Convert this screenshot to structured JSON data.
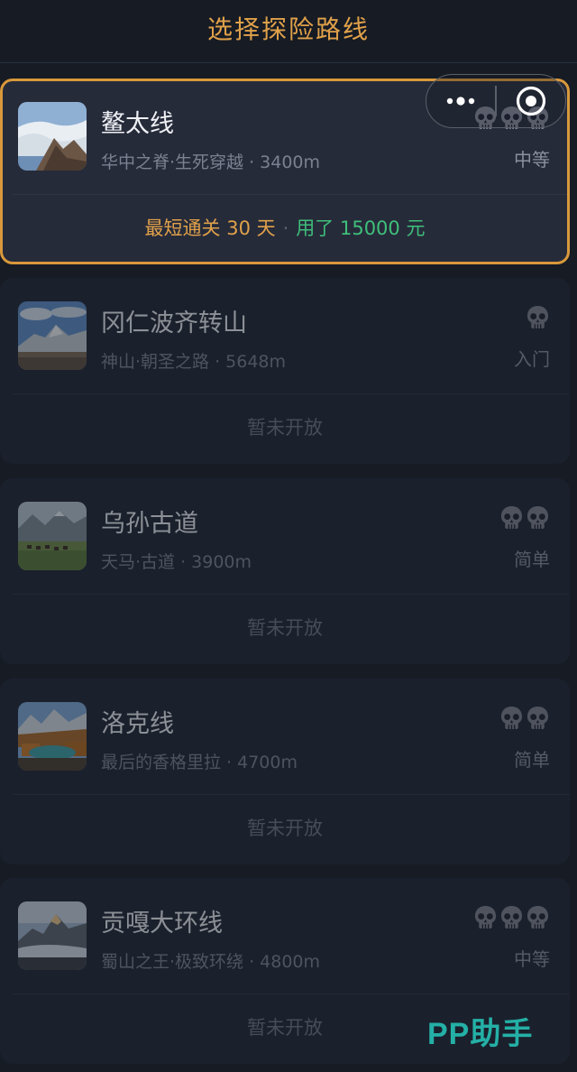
{
  "header": {
    "title": "选择探险路线"
  },
  "capsule": {
    "menu_icon": "more-dots-icon",
    "close_icon": "target-close-icon"
  },
  "routes": [
    {
      "name": "鳌太线",
      "subtitle": "华中之脊·生死穿越 · 3400m",
      "skulls": 3,
      "difficulty": "中等",
      "selected": true,
      "best_clear": "最短通关 30 天",
      "separator": "·",
      "cost": "用了 15000 元"
    },
    {
      "name": "冈仁波齐转山",
      "subtitle": "神山·朝圣之路 · 5648m",
      "skulls": 1,
      "difficulty": "入门",
      "status": "暂未开放"
    },
    {
      "name": "乌孙古道",
      "subtitle": "天马·古道 · 3900m",
      "skulls": 2,
      "difficulty": "简单",
      "status": "暂未开放"
    },
    {
      "name": "洛克线",
      "subtitle": "最后的香格里拉 · 4700m",
      "skulls": 2,
      "difficulty": "简单",
      "status": "暂未开放"
    },
    {
      "name": "贡嘎大环线",
      "subtitle": "蜀山之王·极致环绕 · 4800m",
      "skulls": 3,
      "difficulty": "中等",
      "status": "暂未开放"
    }
  ],
  "watermark": {
    "text": "PP助手"
  },
  "colors": {
    "accent": "#e0a14a",
    "cost": "#3fbf7a",
    "background": "#161b24",
    "card": "#1f2533"
  }
}
